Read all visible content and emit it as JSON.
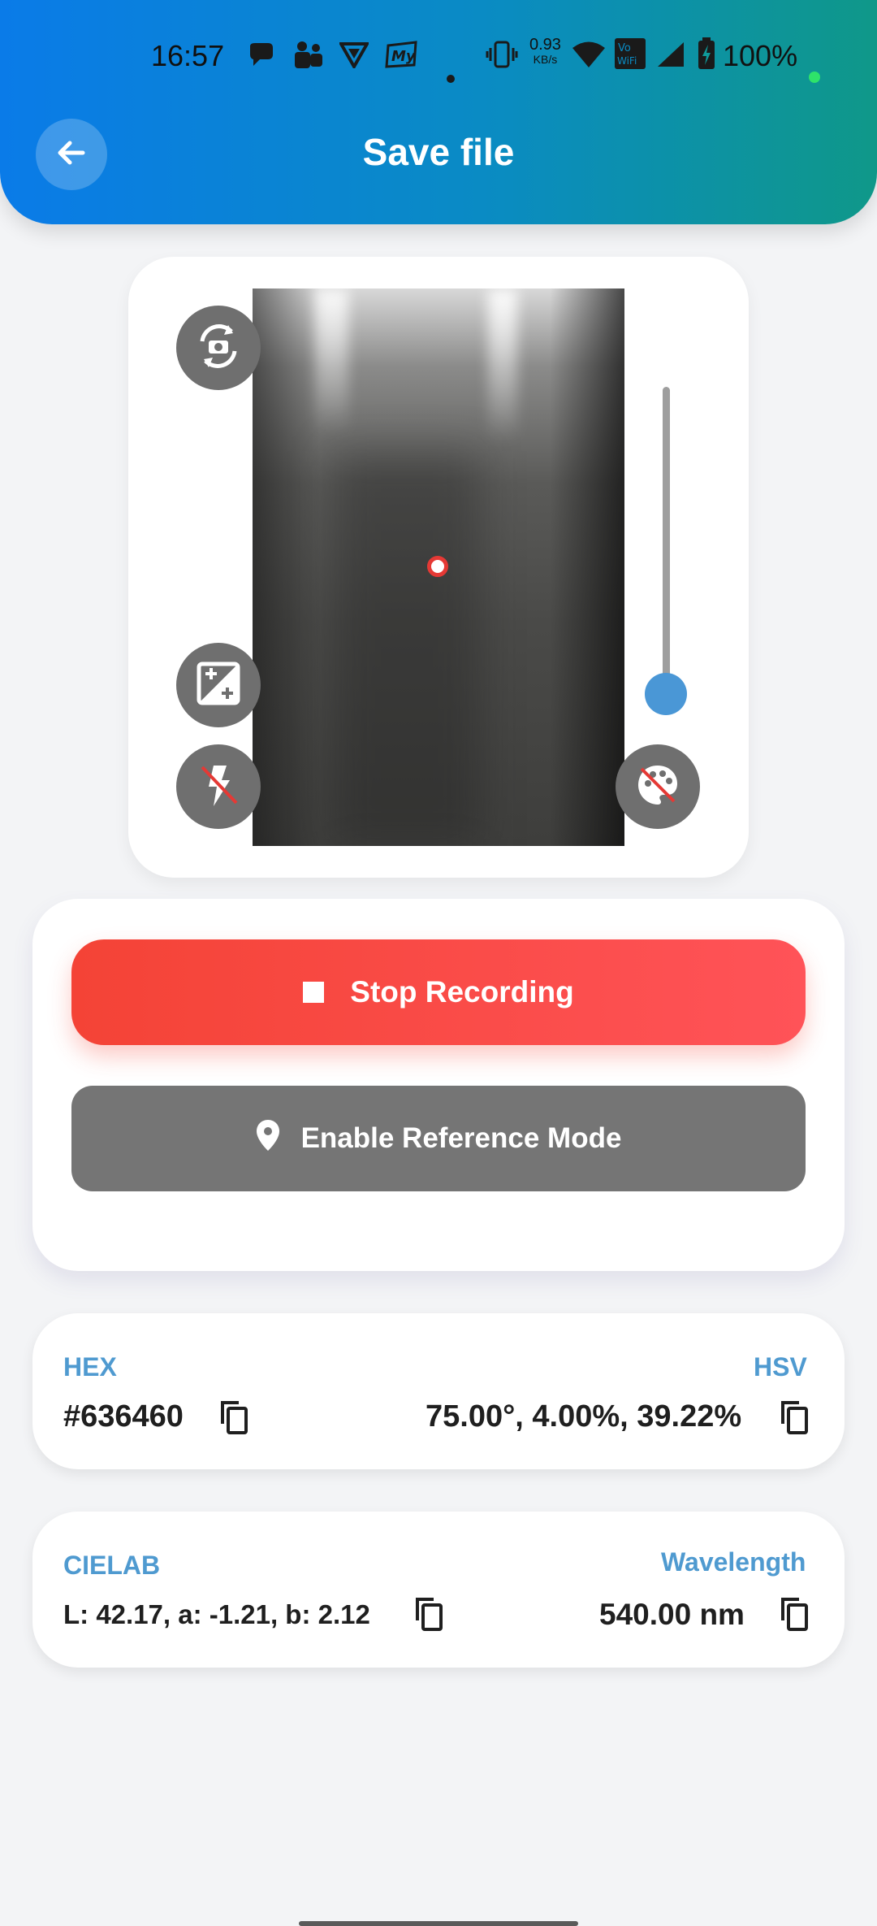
{
  "status_bar": {
    "time": "16:57",
    "net_speed_value": "0.93",
    "net_speed_unit": "KB/s",
    "vowifi_label": "Vo WiFi",
    "battery": "100%",
    "icons": [
      "chat-bubble-icon",
      "teams-icon",
      "vpn-shield-icon",
      "myjio-icon",
      "vibrate-icon",
      "wifi-icon",
      "vowifi-icon",
      "signal-icon",
      "battery-charging-icon"
    ]
  },
  "header": {
    "title": "Save file",
    "back_icon": "arrow-left-icon"
  },
  "camera": {
    "buttons": [
      "switch-camera-icon",
      "exposure-icon",
      "flash-off-icon",
      "palette-off-icon"
    ],
    "zoom_level": 0.0
  },
  "controls": {
    "stop_label": "Stop Recording",
    "reference_label": "Enable Reference Mode"
  },
  "colors_info": {
    "hex_label": "HEX",
    "hex_value": "#636460",
    "hsv_label": "HSV",
    "hsv_value": "75.00°, 4.00%, 39.22%",
    "cielab_label": "CIELAB",
    "cielab_value": "L: 42.17, a: -1.21, b: 2.12",
    "wavelength_label": "Wavelength",
    "wavelength_value": "540.00 nm"
  },
  "theme": {
    "header_gradient_start": "#0a7be8",
    "header_gradient_end": "#0f9889",
    "stop_button_color": "#f44336",
    "reference_button_color": "#757575",
    "label_color": "#4f9ad0"
  }
}
